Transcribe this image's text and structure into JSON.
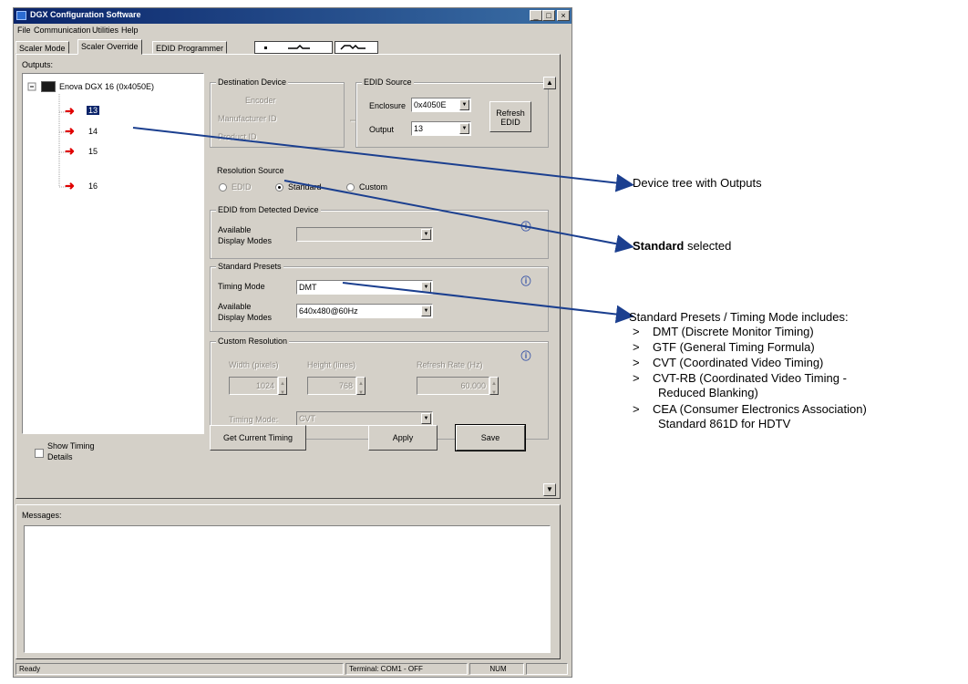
{
  "window": {
    "title": "DGX Configuration Software",
    "controls": {
      "minimize": "_",
      "maximize": "□",
      "close": "×"
    }
  },
  "menu": [
    "File",
    "Communication",
    "Utilities",
    "Help"
  ],
  "tabs": [
    "Scaler Mode",
    "Scaler Override",
    "EDID Programmer"
  ],
  "outputs_label": "Outputs:",
  "tree": {
    "root": "Enova DGX 16 (0x4050E)",
    "items": [
      "13",
      "14",
      "15",
      "16"
    ]
  },
  "show_timing": {
    "line1": "Show Timing",
    "line2": "Details"
  },
  "destination": {
    "title": "Destination Device",
    "row1": "Encoder",
    "row2": "Manufacturer ID",
    "row3": "Product ID"
  },
  "edid_source": {
    "title": "EDID Source",
    "enclosure_label": "Enclosure",
    "enclosure_value": "0x4050E",
    "output_label": "Output",
    "output_value": "13",
    "refresh_button": {
      "line1": "Refresh",
      "line2": "EDID"
    }
  },
  "resolution_source": {
    "title": "Resolution Source",
    "options": [
      "EDID",
      "Standard",
      "Custom"
    ],
    "selected": "Standard"
  },
  "edid_detected": {
    "title": "EDID from Detected Device",
    "available_label_1": "Available",
    "available_label_2": "Display Modes"
  },
  "standard_presets": {
    "title": "Standard Presets",
    "timing_label": "Timing Mode",
    "timing_value": "DMT",
    "available_label_1": "Available",
    "available_label_2": "Display Modes",
    "display_mode_value": "640x480@60Hz"
  },
  "custom_resolution": {
    "title": "Custom Resolution",
    "width_label": "Width (pixels)",
    "height_label": "Height (lines)",
    "refresh_label": "Refresh Rate (Hz)",
    "width_value": "1024",
    "height_value": "768",
    "refresh_value": "60.000",
    "timing_label": "Timing Mode:",
    "timing_value": "CVT"
  },
  "buttons": {
    "get_current": "Get Current Timing",
    "apply": "Apply",
    "save": "Save"
  },
  "messages_label": "Messages:",
  "status": {
    "ready": "Ready",
    "terminal": "Terminal: COM1 - OFF",
    "num": "NUM"
  },
  "annotations": {
    "device_tree": "Device tree with Outputs",
    "standard_bold": "Standard",
    "standard_rest": " selected",
    "presets_heading": "Standard Presets / Timing Mode includes:",
    "bullet": ">",
    "presets": [
      {
        "line1": "DMT (Discrete Monitor Timing)"
      },
      {
        "line1": "GTF (General Timing Formula)"
      },
      {
        "line1": "CVT (Coordinated Video Timing)"
      },
      {
        "line1": "CVT-RB (Coordinated Video Timing -",
        "line2": "Reduced Blanking)"
      },
      {
        "line1": "CEA (Consumer Electronics Association)",
        "line2": "Standard 861D for HDTV"
      }
    ]
  },
  "colors": {
    "callout_line": "#1b3f8f",
    "title_bar": "#0a246a",
    "tree_arrow": "#e00000",
    "selected_node": "#0a246a"
  }
}
